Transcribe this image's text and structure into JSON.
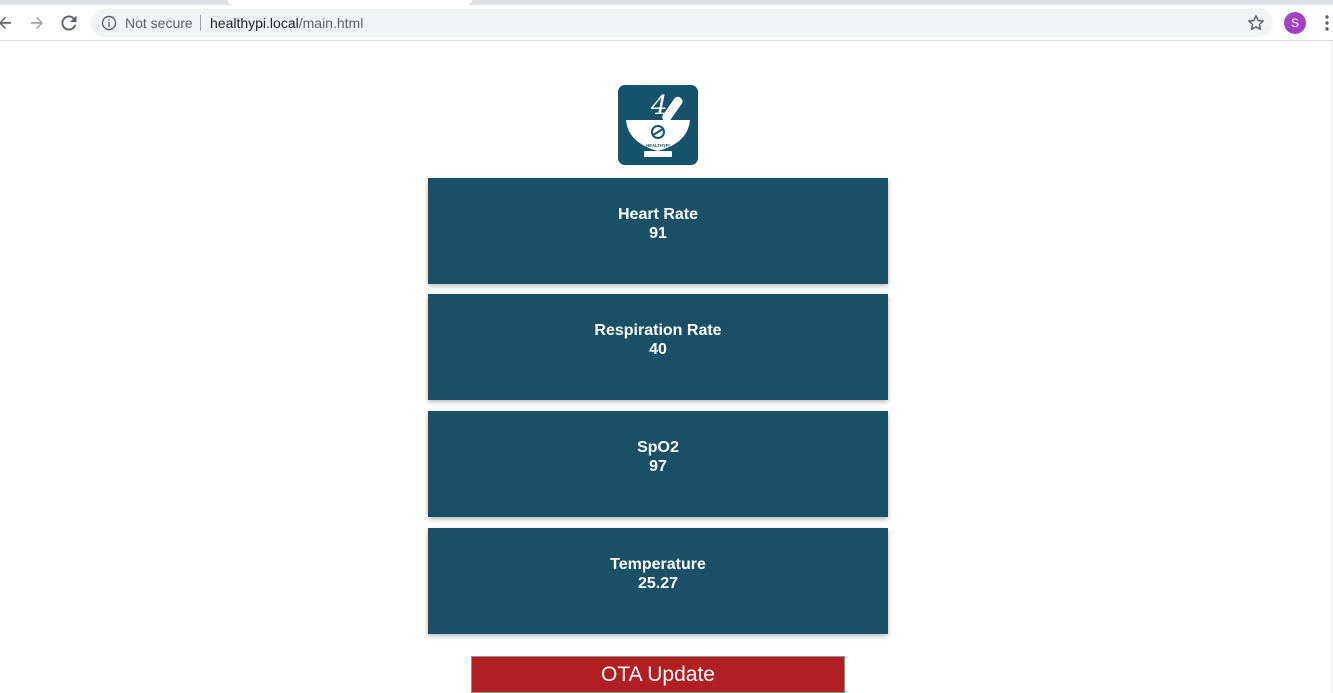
{
  "browser": {
    "security_label": "Not secure",
    "url_host": "healthypi.local",
    "url_path": "/main.html",
    "profile_initial": "S",
    "profile_color": "#a142c2"
  },
  "logo": {
    "brand_text": "HEALTHYPI",
    "number_glyph": "4",
    "background_color": "#14536a"
  },
  "vitals": [
    {
      "label": "Heart Rate",
      "value": "91"
    },
    {
      "label": "Respiration Rate",
      "value": "40"
    },
    {
      "label": "SpO2",
      "value": "97"
    },
    {
      "label": "Temperature",
      "value": "25.27"
    }
  ],
  "card_color": "#195066",
  "ota": {
    "label": "OTA Update",
    "color": "#b11f22"
  }
}
